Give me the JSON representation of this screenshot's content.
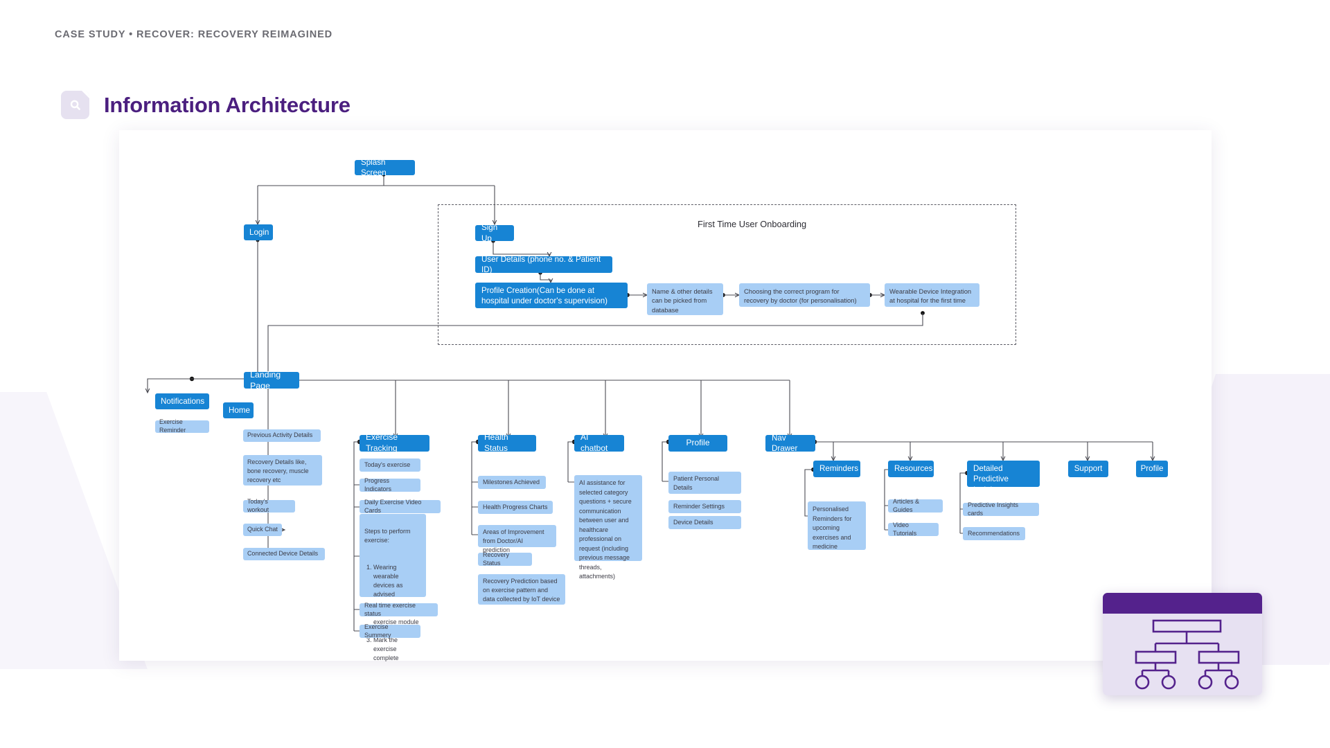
{
  "header": {
    "kicker": "CASE STUDY • RECOVER: RECOVERY REIMAGINED",
    "title": "Information Architecture",
    "title_icon": "document-search-icon",
    "accent_color": "#4b1f7f",
    "badge_color": "#e6e1f0"
  },
  "diagram": {
    "region_label": "First Time  User Onboarding",
    "primary_color": "#1784d4",
    "secondary_color": "#a8cef5",
    "nodes": {
      "splash_screen": "Splash Screen",
      "login": "Login",
      "sign_up": "Sign Up",
      "user_details": "User Details (phone no. & Patient ID)",
      "profile_creation": "Profile Creation(Can be done at hospital under doctor's supervision)",
      "name_details": "Name & other details can be picked from database",
      "choosing_program": "Choosing the correct program for recovery by doctor (for personalisation)",
      "wearable_integration": "Wearable Device Integration at hospital for the first time",
      "landing_page": "Landing Page",
      "notifications": "Notifications",
      "exercise_reminder": "Exercise Reminder",
      "home": "Home",
      "previous_activity": "Previous Activity Details",
      "recovery_details": "Recovery Details like, bone recovery, muscle recovery etc",
      "todays_workout": "Today's workout",
      "quick_chat": "Quick Chat",
      "connected_device": "Connected Device Details",
      "exercise_tracking": "Exercise Tracking",
      "todays_exercise": "Today's exercise",
      "progress_indicators": "Progress Indicators",
      "daily_video_cards": "Daily Exercise Video Cards",
      "steps_to_perform": "Steps to perform exercise:",
      "steps_1": "Wearing wearable devices as advised",
      "steps_2": "Start today's exercise module",
      "steps_3": "Mark the exercise complete",
      "real_time_status": "Real time exercise status",
      "exercise_summary": "Exercise Summery",
      "health_status": "Health Status",
      "milestones_achieved": "Milestones Achieved",
      "health_progress_charts": "Health Progress Charts",
      "areas_of_improvement": "Areas of Improvement from Doctor/AI prediction",
      "recovery_status": "Recovery Status",
      "recovery_prediction": "Recovery Prediction based on exercise pattern and data collected by IoT device",
      "ai_chatbot": "AI chatbot",
      "ai_assistance": "AI assistance for selected category questions + secure communication between user and healthcare professional on request (including previous message threads, attachments)",
      "profile": "Profile",
      "patient_personal_details": "Patient Personal Details",
      "reminder_settings": "Reminder Settings",
      "device_details": "Device Details",
      "nav_drawer": "Nav Drawer",
      "reminders": "Reminders",
      "personalised_reminders": "Personalised Reminders for upcoming exercises and medicine",
      "resources": "Resources",
      "articles_guides": "Articles & Guides",
      "video_tutorials": "Video Tutorials",
      "detailed_predictive_insights": "Detailed Predictive Insights",
      "predictive_insights_cards": "Predictive Insights cards",
      "recommendations": "Recommendations",
      "support": "Support",
      "nav_profile": "Profile"
    }
  },
  "sitemap_card": {
    "icon": "sitemap-icon",
    "bar_color": "#54228c",
    "body_color": "#e7e1f2"
  }
}
